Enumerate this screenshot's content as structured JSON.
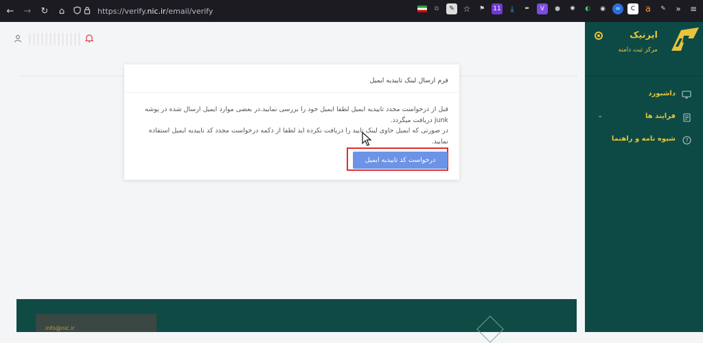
{
  "browser": {
    "url_prefix": "https://verify.",
    "url_domain": "nic.ir",
    "url_path": "/email/verify",
    "extension_badge": "11",
    "icons": [
      "back-icon",
      "forward-icon",
      "reload-icon",
      "home-icon",
      "shield-icon",
      "lock-icon",
      "star-icon",
      "download-icon",
      "menu-icon"
    ]
  },
  "header": {
    "user_icon": "person-icon",
    "bell_icon": "bell-icon"
  },
  "card": {
    "title": "فرم ارسال لینک تاییدیه ایمیل",
    "paragraph1": "قبل از درخواست مجدد تاییدیه ایمیل لطفا ایمیل خود را بررسی نمایید.در بعضی موارد ایمیل ارسال شده در پوشه junk دریافت میگردد.",
    "paragraph2": "در صورتی که ایمیل حاوی لینک تایید را دریافت نکرده اید لطفا از دکمه درخواست مجدد کد تاییدیه ایمیل استفاده نمایید.",
    "button": "درخواست کد تاییدیه ایمیل"
  },
  "footer": {
    "email": "info@nic.ir"
  },
  "sidebar": {
    "brand": "ایرنیک",
    "subtitle": "مرکز ثبت دامنه",
    "items": [
      {
        "label": "داشبورد",
        "icon": "monitor-icon"
      },
      {
        "label": "فرایند ها",
        "icon": "document-icon"
      },
      {
        "label": "شیوه نامه و راهنما",
        "icon": "help-icon"
      }
    ]
  },
  "colors": {
    "sidebar_bg": "#0d4a45",
    "accent_gold": "#e9c339",
    "button_blue": "#6d93e6",
    "highlight_red": "#e22a2a"
  }
}
